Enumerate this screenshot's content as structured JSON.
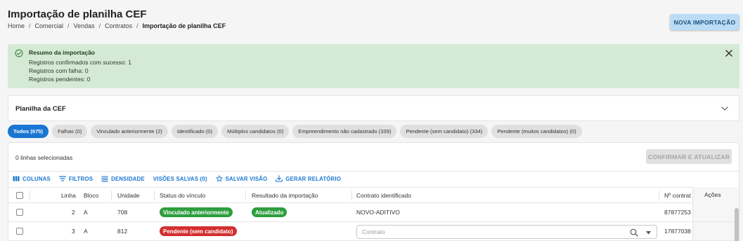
{
  "header": {
    "title": "Importação de planilha CEF",
    "breadcrumb": [
      "Home",
      "Comercial",
      "Vendas",
      "Contratos",
      "Importação de planilha CEF"
    ],
    "new_import_label": "NOVA IMPORTAÇÃO"
  },
  "alert": {
    "title": "Resumo da importação",
    "lines": [
      "Registros confirmados com sucesso: 1",
      "Registros com falha: 0",
      "Registros pendentes: 0"
    ],
    "background_color": "#d5ead5",
    "icon": "check-circle-icon"
  },
  "panel": {
    "title": "Planilha da CEF",
    "icon": "chevron-down-icon"
  },
  "filters": [
    {
      "label": "Todos (675)",
      "active": true
    },
    {
      "label": "Falhas (0)",
      "active": false
    },
    {
      "label": "Vinculado anteriormente (2)",
      "active": false
    },
    {
      "label": "Identificado (0)",
      "active": false
    },
    {
      "label": "Múltiplos candidatos (0)",
      "active": false
    },
    {
      "label": "Empreendimento não cadastrado (339)",
      "active": false
    },
    {
      "label": "Pendente (sem candidato) (334)",
      "active": false
    },
    {
      "label": "Pendente (muitos candidatos) (0)",
      "active": false
    }
  ],
  "grid": {
    "selected_text": "0 linhas selecionadas",
    "confirm_label": "CONFIRMAR E ATUALIZAR",
    "toolbar": {
      "columns": "COLUNAS",
      "filters": "FILTROS",
      "density": "DENSIDADE",
      "saved_views": "VISÕES SALVAS (0)",
      "save_view": "SALVAR VISÃO",
      "report": "GERAR RELATÓRIO"
    },
    "columns": {
      "linha": "Linha",
      "bloco": "Bloco",
      "unidade": "Unidade",
      "status": "Status do vínculo",
      "resultado": "Resultado da importação",
      "contrato": "Contrato identificado",
      "numero": "Nº contrat",
      "acoes": "Ações"
    },
    "rows": [
      {
        "linha": "2",
        "bloco": "A",
        "unidade": "708",
        "status": "Vinculado anteriormente",
        "status_color": "#2e9e3e",
        "resultado": "Atualizado",
        "contrato": "NOVO-ADITIVO",
        "numero": "87877253"
      },
      {
        "linha": "3",
        "bloco": "A",
        "unidade": "812",
        "status": "Pendente (sem candidato)",
        "status_color": "#d32f2f",
        "resultado": "",
        "contrato_placeholder": "Contrato",
        "numero": "17877038"
      }
    ]
  },
  "colors": {
    "primary": "#1976d2",
    "success": "#2e9e3e",
    "error": "#d32f2f"
  }
}
